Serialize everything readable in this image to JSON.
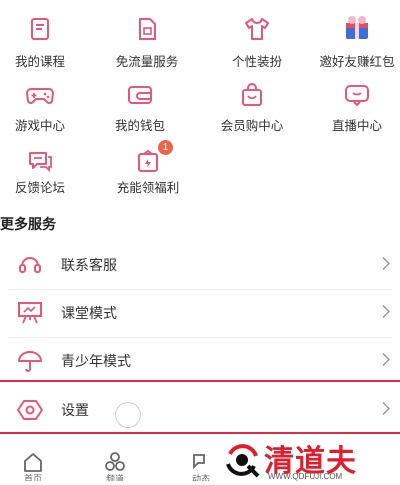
{
  "grid": [
    {
      "label": "我的课程",
      "icon": "course-book-icon"
    },
    {
      "label": "免流量服务",
      "icon": "sim-card-icon"
    },
    {
      "label": "个性装扮",
      "icon": "tshirt-icon"
    },
    {
      "label": "邀好友赚红包",
      "icon": "gift-box-icon"
    },
    {
      "label": "游戏中心",
      "icon": "gamepad-icon"
    },
    {
      "label": "我的钱包",
      "icon": "wallet-icon"
    },
    {
      "label": "会员购中心",
      "icon": "shopping-bag-icon"
    },
    {
      "label": "直播中心",
      "icon": "live-tv-icon"
    },
    {
      "label": "反馈论坛",
      "icon": "chat-bubbles-icon"
    },
    {
      "label": "充能领福利",
      "icon": "energy-gift-icon",
      "badge": "1"
    }
  ],
  "more_services": {
    "title": "更多服务",
    "items": [
      {
        "label": "联系客服",
        "icon": "headset-icon"
      },
      {
        "label": "课堂模式",
        "icon": "classroom-board-icon"
      },
      {
        "label": "青少年模式",
        "icon": "umbrella-icon"
      },
      {
        "label": "设置",
        "icon": "settings-hexagon-icon"
      }
    ]
  },
  "tabbar": [
    {
      "label": "首页",
      "icon": "home-icon"
    },
    {
      "label": "频道",
      "icon": "channel-icon"
    },
    {
      "label": "动态",
      "icon": "dynamic-icon"
    }
  ],
  "watermark": {
    "brand": "清道夫",
    "url": "WWW.QDFUJI.COM"
  },
  "colors": {
    "accent": "#e8577a",
    "highlight_line": "#e02a4c",
    "watermark": "#e11d2e"
  }
}
